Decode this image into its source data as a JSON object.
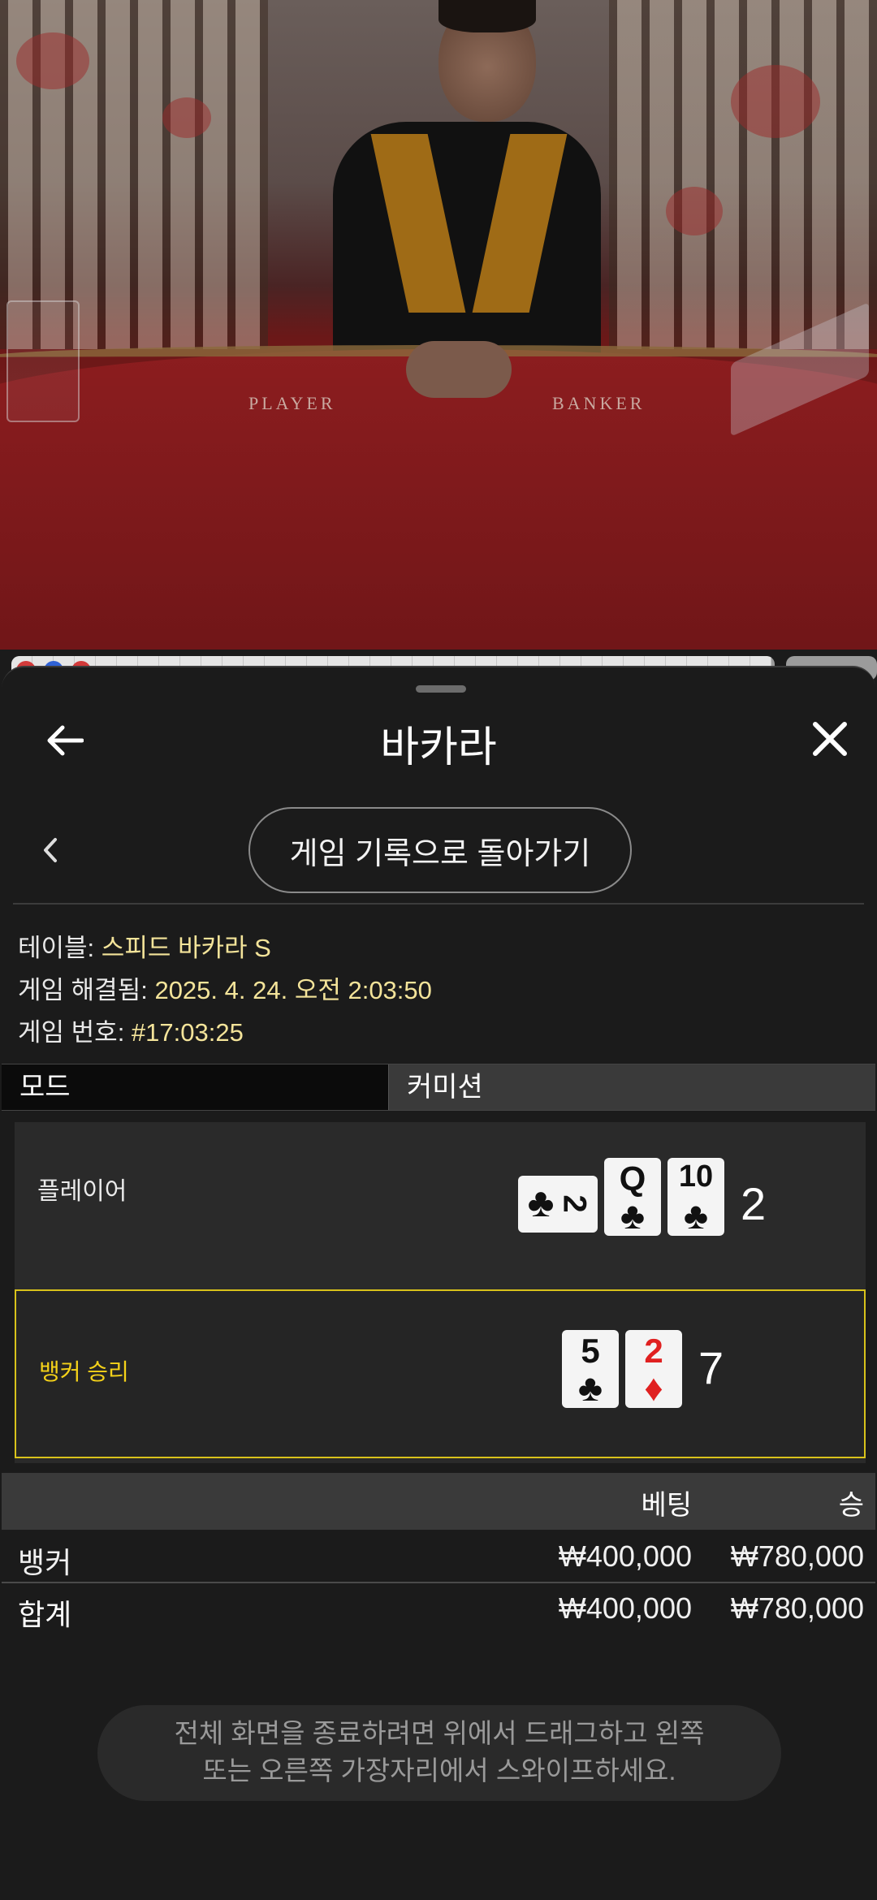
{
  "video": {
    "table_labels": [
      "PLAYER",
      "BANKER"
    ]
  },
  "header": {
    "title": "바카라",
    "back_icon": "arrow-left-icon",
    "close_icon": "close-icon"
  },
  "nav": {
    "prev_icon": "chevron-left-icon",
    "back_to_history_label": "게임 기록으로 돌아가기"
  },
  "game_info": {
    "table_label": "테이블: ",
    "table_value": "스피드 바카라 S",
    "resolved_label": "게임 해결됨: ",
    "resolved_value": "2025. 4. 24. 오전 2:03:50",
    "number_label": "게임 번호: ",
    "number_value": "#17:03:25"
  },
  "mode": {
    "label": "모드",
    "value": "커미션"
  },
  "result": {
    "player": {
      "label": "플레이어",
      "cards": [
        {
          "rank": "2",
          "suit": "♣",
          "color": "#111111",
          "rotated": true
        },
        {
          "rank": "Q",
          "suit": "♣",
          "color": "#111111",
          "rotated": false
        },
        {
          "rank": "10",
          "suit": "♣",
          "color": "#111111",
          "rotated": false
        }
      ],
      "total": "2"
    },
    "banker": {
      "label": "뱅커 승리",
      "cards": [
        {
          "rank": "5",
          "suit": "♣",
          "color": "#111111",
          "rotated": false
        },
        {
          "rank": "2",
          "suit": "♦",
          "color": "#e02020",
          "rotated": false
        }
      ],
      "total": "7"
    }
  },
  "bets_table": {
    "headers": {
      "bet": "베팅",
      "win": "승"
    },
    "rows": [
      {
        "name": "뱅커",
        "bet": "₩400,000",
        "win": "₩780,000"
      }
    ],
    "total": {
      "name": "합계",
      "bet": "₩400,000",
      "win": "₩780,000"
    }
  },
  "hint": {
    "line1": "전체 화면을 종료하려면 위에서 드래그하고 왼쪽",
    "line2": "또는 오른쪽 가장자리에서 스와이프하세요."
  },
  "colors": {
    "accent_yellow": "#d8c21b",
    "value_text": "#f4e49a",
    "banker_win": "#f5d219"
  }
}
